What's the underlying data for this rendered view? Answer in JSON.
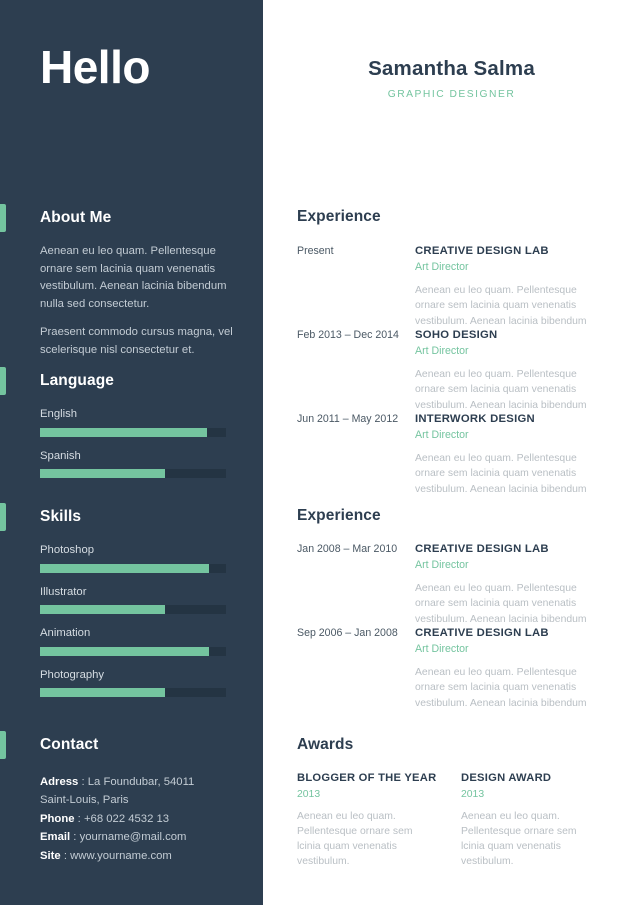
{
  "colors": {
    "sidebar_bg": "#2d3e50",
    "accent_green": "#74c49f",
    "meter_track": "#243443",
    "heading_dark": "#2d3e50",
    "body_light": "#c3ccd4",
    "body_muted": "#b9bfc4",
    "page_bg": "#ffffff"
  },
  "sidebar": {
    "greeting": "Hello",
    "about": {
      "title": "About Me",
      "paragraphs": [
        "Aenean eu leo quam. Pellentesque ornare sem lacinia quam venenatis vestibulum. Aenean lacinia bibendum nulla sed consectetur.",
        "Praesent commodo cursus magna, vel scelerisque nisl consectetur et."
      ]
    },
    "language": {
      "title": "Language",
      "items": [
        {
          "label": "English",
          "value": 90
        },
        {
          "label": "Spanish",
          "value": 67
        }
      ]
    },
    "skills": {
      "title": "Skills",
      "items": [
        {
          "label": "Photoshop",
          "value": 91
        },
        {
          "label": "Illustrator",
          "value": 67
        },
        {
          "label": "Animation",
          "value": 91
        },
        {
          "label": "Photography",
          "value": 67
        }
      ]
    },
    "contact": {
      "title": "Contact",
      "lines": [
        {
          "label": "Adress",
          "sep": " : ",
          "value": "La Foundubar, 54011"
        },
        {
          "label": "",
          "sep": "",
          "value": "Saint-Louis, Paris"
        },
        {
          "label": "Phone",
          "sep": " : ",
          "value": "+68 022 4532 13"
        },
        {
          "label": "Email",
          "sep": " :  ",
          "value": "yourname@mail.com"
        },
        {
          "label": "Site",
          "sep": " :  ",
          "value": "www.yourname.com"
        }
      ]
    }
  },
  "header": {
    "name": "Samantha Salma",
    "title": "GRAPHIC DESIGNER"
  },
  "main": {
    "experience_1": {
      "heading": "Experience",
      "entries": [
        {
          "date": "Present",
          "company": "CREATIVE DESIGN LAB",
          "role": "Art Director",
          "description": "Aenean eu leo quam. Pellentesque ornare sem lacinia quam venenatis vestibulum. Aenean lacinia bibendum"
        },
        {
          "date": "Feb 2013 – Dec 2014",
          "company": "SOHO DESIGN",
          "role": "Art Director",
          "description": "Aenean eu leo quam. Pellentesque ornare sem lacinia quam venenatis vestibulum. Aenean lacinia bibendum"
        },
        {
          "date": "Jun 2011 – May 2012",
          "company": "INTERWORK DESIGN",
          "role": "Art Director",
          "description": "Aenean eu leo quam. Pellentesque ornare sem lacinia quam venenatis vestibulum. Aenean lacinia bibendum"
        }
      ]
    },
    "experience_2": {
      "heading": "Experience",
      "entries": [
        {
          "date": "Jan 2008 – Mar 2010",
          "company": "CREATIVE DESIGN LAB",
          "role": "Art Director",
          "description": "Aenean eu leo quam. Pellentesque ornare sem lacinia quam venenatis vestibulum. Aenean lacinia bibendum"
        },
        {
          "date": "Sep 2006 – Jan 2008",
          "company": "CREATIVE DESIGN LAB",
          "role": "Art Director",
          "description": "Aenean eu leo quam. Pellentesque ornare sem lacinia quam venenatis vestibulum. Aenean lacinia bibendum"
        }
      ]
    },
    "awards": {
      "heading": "Awards",
      "items": [
        {
          "title": "BLOGGER OF THE YEAR",
          "year": "2013",
          "description": "Aenean eu leo quam. Pellentesque ornare sem lcinia quam venenatis vestibulum."
        },
        {
          "title": "DESIGN AWARD",
          "year": "2013",
          "description": "Aenean eu leo quam. Pellentesque ornare sem lcinia quam venenatis vestibulum."
        }
      ]
    }
  }
}
